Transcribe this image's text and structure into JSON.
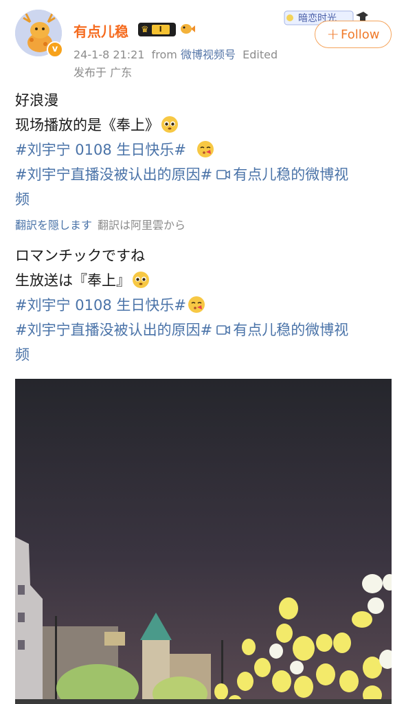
{
  "post": {
    "username": "有点儿稳",
    "level": "I",
    "date": "24-1-8 21:21",
    "from_word": "from",
    "source": "微博视频号",
    "edited": "Edited",
    "location": "发布于 广东",
    "follow_label": "Follow",
    "sticker_text": "暗恋时光"
  },
  "original": {
    "line1": "好浪漫",
    "line2": "现场播放的是《奉上》",
    "tag1": "#刘宇宁 0108 生日快乐#",
    "tag2": "#刘宇宁直播没被认出的原因#",
    "video_link": "有点儿稳的微博视",
    "video_link_tail": "频"
  },
  "translation_bar": {
    "hide": "翻訳を隠します",
    "credit": "翻訳は阿里雲から"
  },
  "translated": {
    "line1": "ロマンチックですね",
    "line2": "生放送は『奉上』",
    "tag1": "#刘宇宁 0108 生日快乐#",
    "tag2": "#刘宇宁直播没被认出的原因#",
    "video_link": "有点儿稳的微博视",
    "video_link_tail": "频"
  },
  "colors": {
    "username": "#f56a1d",
    "link": "#4a73a8",
    "meta": "#8c8c8c",
    "follow_border": "#f5a35a"
  }
}
